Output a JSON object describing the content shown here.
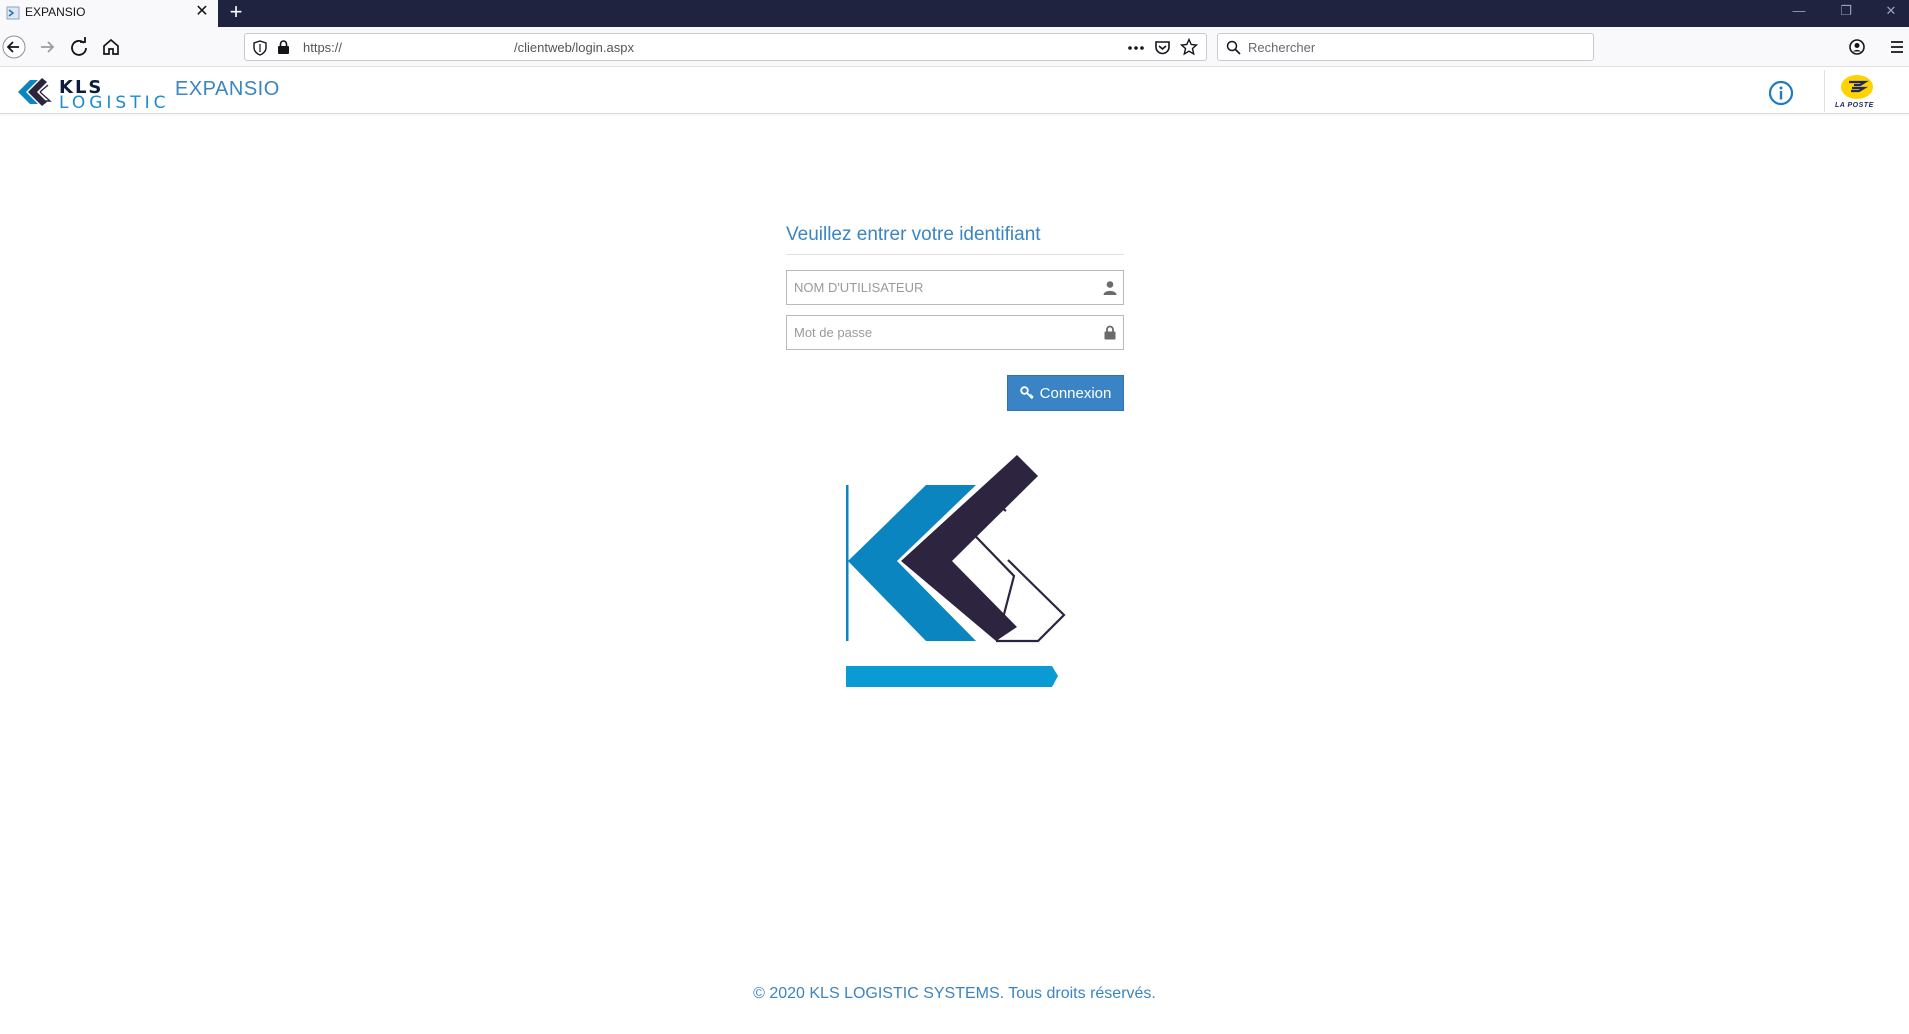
{
  "browser": {
    "tab_title": "EXPANSIO",
    "tab_close": "✕",
    "new_tab": "+",
    "url_scheme": "https://",
    "url_path": "/clientweb/login.aspx",
    "search_placeholder": "Rechercher",
    "window_buttons": [
      "—",
      "❐",
      "✕"
    ]
  },
  "header": {
    "logo_word": "KLS",
    "logo_sub": "LOGISTIC",
    "app_name": "EXPANSIO",
    "partner_label": "LA POSTE"
  },
  "login": {
    "title": "Veuillez entrer votre identifiant",
    "username_placeholder": "NOM D'UTILISATEUR",
    "username_value": "",
    "password_placeholder": "Mot de passe",
    "password_value": "",
    "submit_label": "Connexion"
  },
  "footer": {
    "copyright": "© 2020 KLS LOGISTIC SYSTEMS. Tous droits réservés."
  },
  "colors": {
    "accent": "#3a85c2",
    "button": "#3a84c6",
    "logo_dark": "#2d2540",
    "logo_blue": "#0b85bf",
    "tabbar": "#202340"
  },
  "icons": [
    "back-arrow-icon",
    "forward-arrow-icon",
    "reload-icon",
    "home-icon",
    "shield-icon",
    "lock-icon",
    "more-icon",
    "pocket-icon",
    "star-icon",
    "search-icon",
    "account-icon",
    "menu-icon",
    "info-icon",
    "user-icon",
    "padlock-icon",
    "key-icon"
  ]
}
